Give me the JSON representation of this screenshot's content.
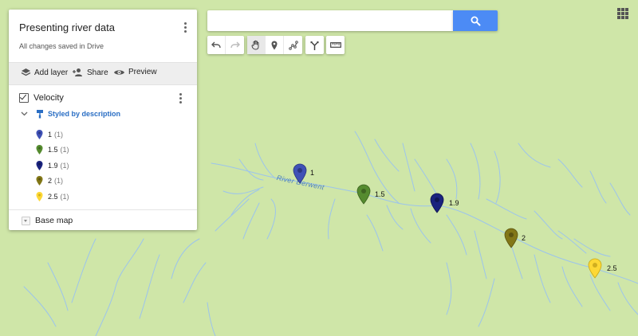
{
  "panel": {
    "title": "Presenting river data",
    "saved_status": "All changes saved in Drive",
    "actions": {
      "add_layer": "Add layer",
      "share": "Share",
      "preview": "Preview"
    },
    "layer": {
      "name": "Velocity",
      "checked": true,
      "style_label": "Styled by description",
      "legend": [
        {
          "label": "1",
          "count": "(1)",
          "color": "#3f51b5"
        },
        {
          "label": "1.5",
          "count": "(1)",
          "color": "#558b2f"
        },
        {
          "label": "1.9",
          "count": "(1)",
          "color": "#1a237e"
        },
        {
          "label": "2",
          "count": "(1)",
          "color": "#827717"
        },
        {
          "label": "2.5",
          "count": "(1)",
          "color": "#fdd835"
        }
      ]
    },
    "base_map": "Base map"
  },
  "search": {
    "value": "",
    "placeholder": ""
  },
  "tools": [
    "undo-icon",
    "redo-icon",
    "hand-icon",
    "marker-icon",
    "line-icon",
    "directions-icon",
    "ruler-icon"
  ],
  "map": {
    "river_label": "River Derwent",
    "markers": [
      {
        "label": "1",
        "color": "#3f51b5"
      },
      {
        "label": "1.5",
        "color": "#558b2f"
      },
      {
        "label": "1.9",
        "color": "#1a237e"
      },
      {
        "label": "2",
        "color": "#827717"
      },
      {
        "label": "2.5",
        "color": "#fdd835"
      }
    ]
  },
  "colors": {
    "map_background": "#cfe6a8",
    "river": "#9cc4ec",
    "accent": "#4c8bf5"
  }
}
